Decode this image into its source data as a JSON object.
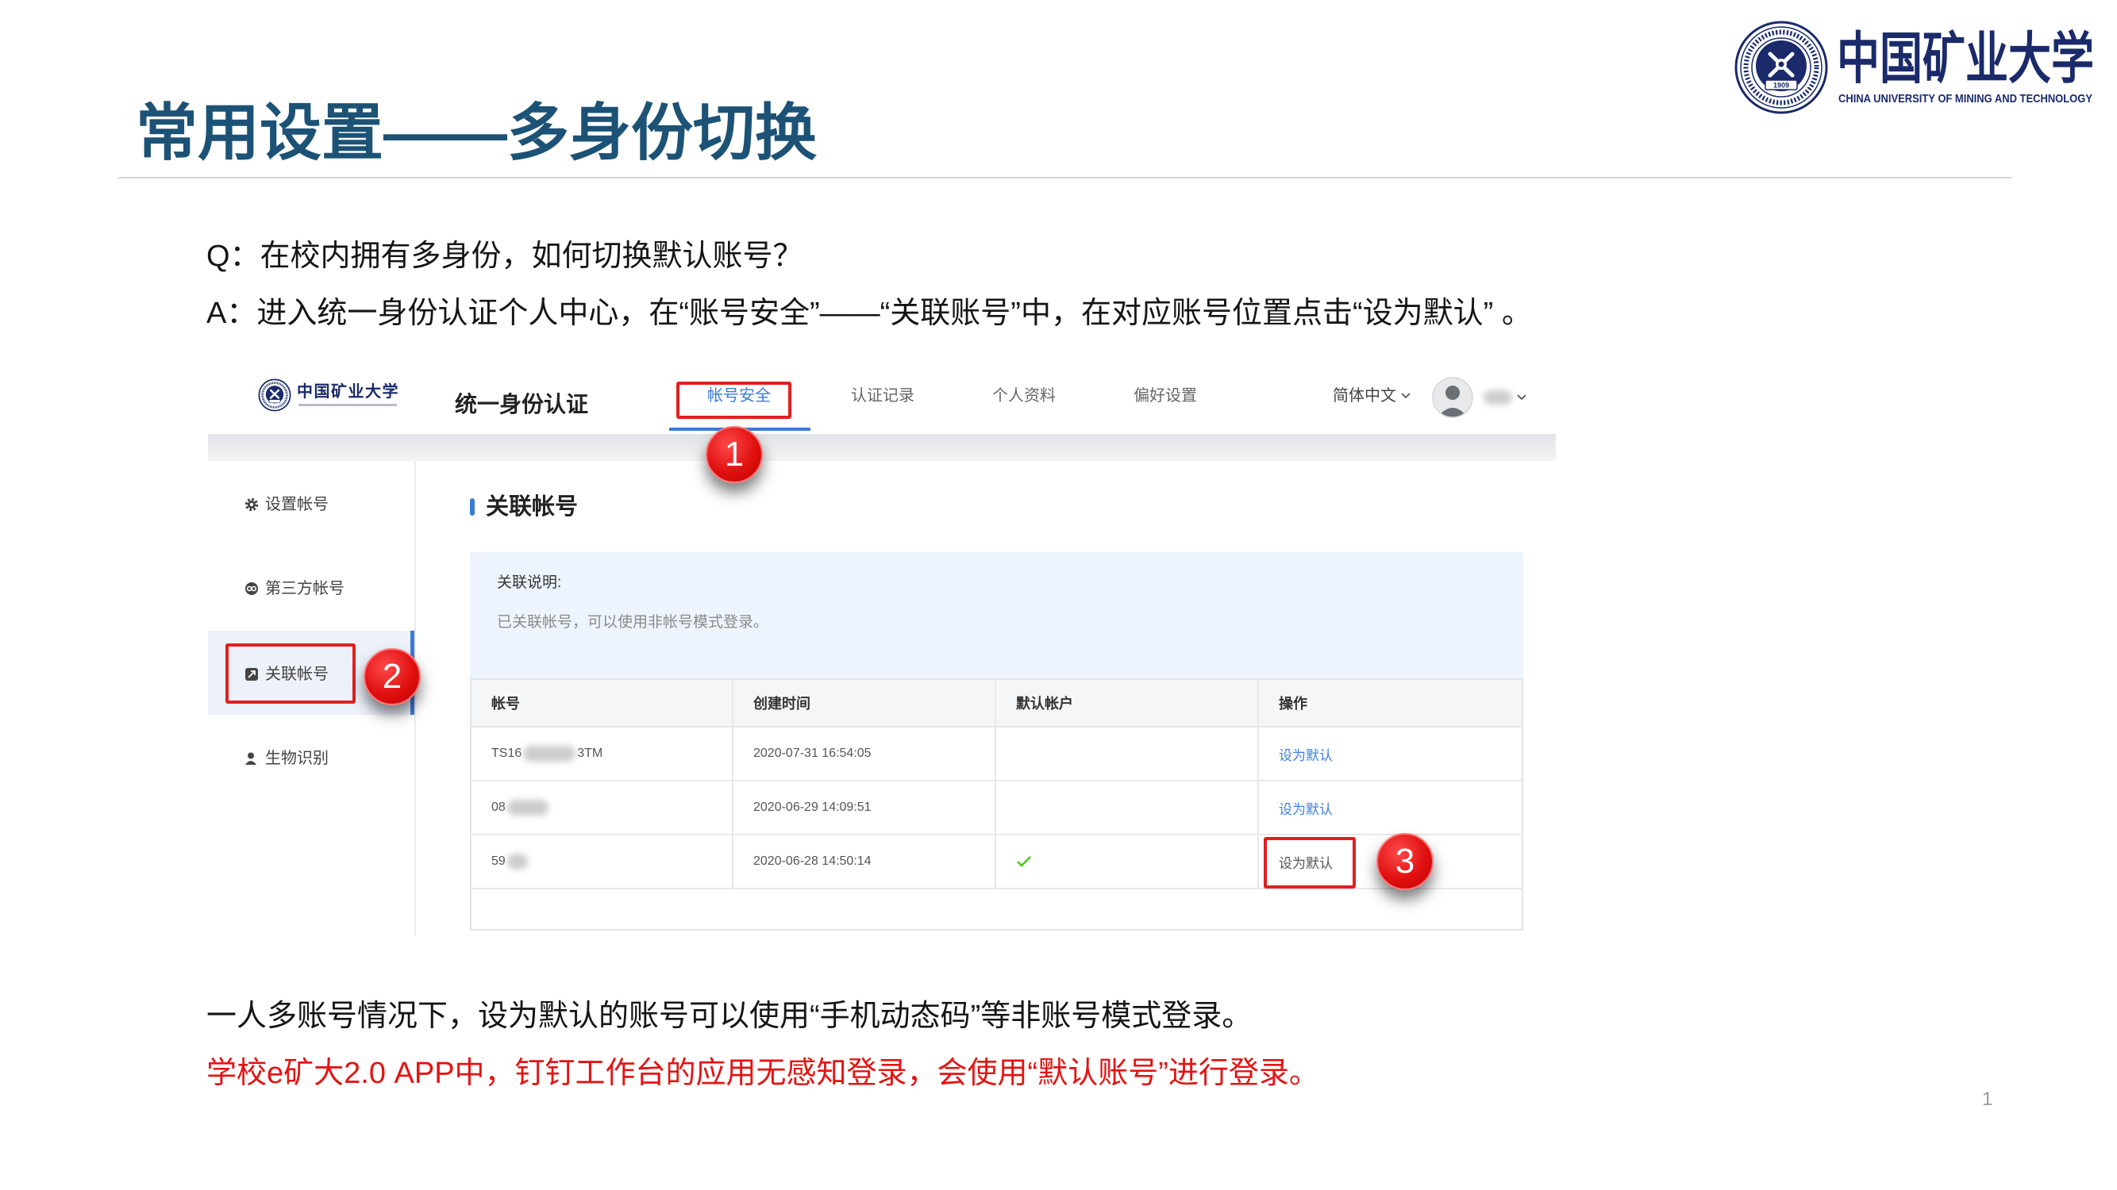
{
  "slide": {
    "title": "常用设置——多身份切换",
    "question": "Q：在校内拥有多身份，如何切换默认账号？",
    "answer": "A：进入统一身份认证个人中心，在“账号安全”——“关联账号”中，在对应账号位置点击“设为默认” 。",
    "note": "一人多账号情况下，设为默认的账号可以使用“手机动态码”等非账号模式登录。",
    "note_red": "学校e矿大2.0 APP中，钉钉工作台的应用无感知登录，会使用“默认账号”进行登录。",
    "page_number": "1"
  },
  "logo": {
    "icon": "university-emblem-icon",
    "name_cn": "中国矿业大学",
    "name_en": "CHINA UNIVERSITY OF MINING AND TECHNOLOGY",
    "emblem_year": "1909"
  },
  "screenshot": {
    "header": {
      "logo_icon": "university-emblem-icon",
      "logo_cn": "中国矿业大学",
      "app_title": "统一身份认证",
      "tabs": [
        {
          "label": "帐号安全",
          "active": true
        },
        {
          "label": "认证记录",
          "active": false
        },
        {
          "label": "个人资料",
          "active": false
        },
        {
          "label": "偏好设置",
          "active": false
        }
      ],
      "language": "简体中文",
      "language_icon": "chevron-down-icon",
      "avatar_icon": "user-avatar-icon",
      "user_menu_icon": "chevron-down-icon"
    },
    "sidebar": {
      "items": [
        {
          "label": "设置帐号",
          "icon": "gear-icon",
          "active": false
        },
        {
          "label": "第三方帐号",
          "icon": "third-party-icon",
          "active": false
        },
        {
          "label": "关联帐号",
          "icon": "link-icon",
          "active": true
        },
        {
          "label": "生物识别",
          "icon": "user-icon",
          "active": false
        }
      ]
    },
    "main": {
      "heading": "关联帐号",
      "info": {
        "title": "关联说明:",
        "text": "已关联帐号，可以使用非帐号模式登录。"
      },
      "table": {
        "columns": [
          "帐号",
          "创建时间",
          "默认帐户",
          "操作"
        ],
        "rows": [
          {
            "account_prefix": "TS16",
            "account_suffix": "3TM",
            "created": "2020-07-31 16:54:05",
            "is_default": false,
            "action": "设为默认"
          },
          {
            "account_prefix": "08",
            "created": "2020-06-29 14:09:51",
            "is_default": false,
            "action": "设为默认"
          },
          {
            "account_prefix": "59",
            "created": "2020-06-28 14:50:14",
            "is_default": true,
            "action": "设为默认"
          }
        ]
      }
    }
  },
  "callouts": [
    {
      "number": "1"
    },
    {
      "number": "2"
    },
    {
      "number": "3"
    }
  ],
  "colors": {
    "title": "#1c5275",
    "logo_navy": "#1a2a6a",
    "accent_blue": "#3b7bd6",
    "callout_red": "#e02020",
    "note_red": "#e31414",
    "check_green": "#52c41a"
  }
}
